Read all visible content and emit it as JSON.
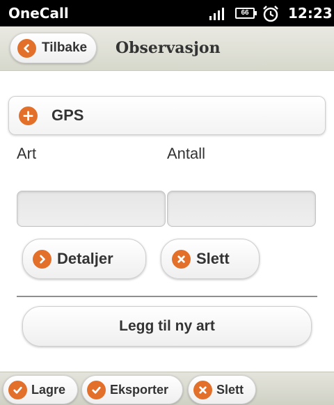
{
  "status_bar": {
    "carrier": "OneCall",
    "battery": "66",
    "time": "12:23"
  },
  "header": {
    "back_label": "Tilbake",
    "title": "Observasjon"
  },
  "gps": {
    "label": "GPS"
  },
  "fields": {
    "art_label": "Art",
    "antall_label": "Antall",
    "art_value": "",
    "antall_value": ""
  },
  "actions": {
    "detaljer_label": "Detaljer",
    "slett_label": "Slett",
    "add_label": "Legg til ny art"
  },
  "toolbar": {
    "lagre_label": "Lagre",
    "eksporter_label": "Eksporter",
    "slett_label": "Slett"
  },
  "colors": {
    "accent": "#e2702a",
    "header_bg": "#dcdcd2"
  }
}
